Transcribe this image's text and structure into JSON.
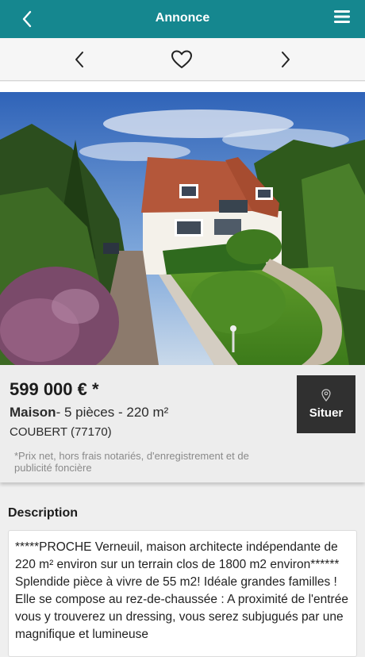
{
  "header": {
    "title": "Annonce"
  },
  "listing": {
    "price": "599 000 € *",
    "type": "Maison",
    "details": "- 5 pièces - 220 m²",
    "city": "COUBERT (77170)",
    "note": "*Prix net, hors frais notariés, d'enregistrement et de publicité foncière",
    "locate_label": "Situer"
  },
  "description": {
    "heading": "Description",
    "text": "*****PROCHE Verneuil, maison architecte indépendante de 220 m² environ sur un terrain clos de 1800 m2 environ****** Splendide pièce à vivre de 55 m2! Idéale grandes familles ! Elle se compose au rez-de-chaussée : A proximité de l'entrée vous y trouverez un dressing, vous serez subjugués par une magnifique et lumineuse"
  },
  "icons": {
    "back": "chevron-left-icon",
    "menu": "hamburger-menu-icon",
    "prev": "chevron-left-icon",
    "favorite": "heart-outline-icon",
    "next": "chevron-right-icon",
    "locate": "map-pin-icon"
  },
  "colors": {
    "header": "#15878f",
    "locate_button": "#303030"
  }
}
